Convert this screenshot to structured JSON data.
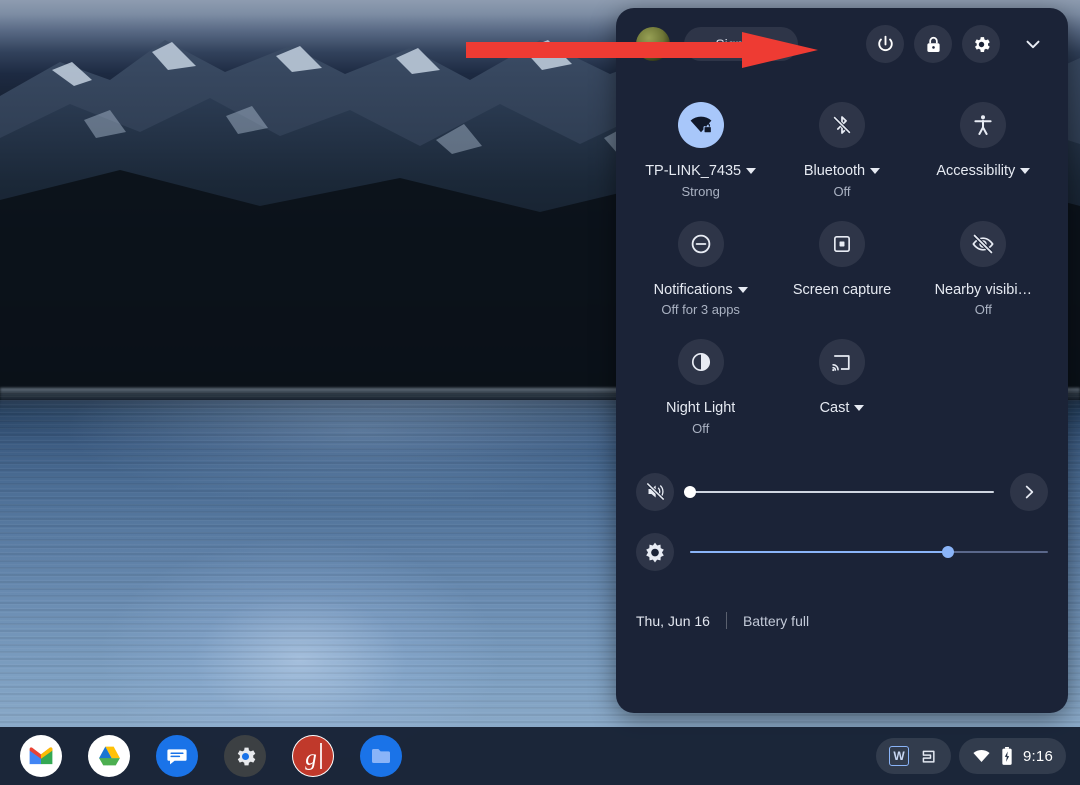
{
  "desktop": {
    "wallpaper_name": "mountain-lake-night-wallpaper"
  },
  "annotation": {
    "arrow_name": "red-pointer-arrow",
    "color": "#ee3b33",
    "points_at": "power-button"
  },
  "quick_settings": {
    "header": {
      "avatar_name": "user-avatar",
      "sign_out_label": "Sign out",
      "power_title": "Power",
      "lock_title": "Lock",
      "settings_title": "Settings",
      "collapse_title": "Collapse"
    },
    "tiles": [
      {
        "name": "network",
        "icon": "wifi-locked-icon",
        "label": "TP-LINK_7435",
        "sub": "Strong",
        "has_caret": true,
        "active": true
      },
      {
        "name": "bluetooth",
        "icon": "bluetooth-disabled-icon",
        "label": "Bluetooth",
        "sub": "Off",
        "has_caret": true,
        "active": false
      },
      {
        "name": "accessibility",
        "icon": "accessibility-icon",
        "label": "Accessibility",
        "sub": "",
        "has_caret": true,
        "active": false
      },
      {
        "name": "notifications",
        "icon": "do-not-disturb-icon",
        "label": "Notifications",
        "sub": "Off for 3 apps",
        "has_caret": true,
        "active": false
      },
      {
        "name": "screen-capture",
        "icon": "screen-capture-icon",
        "label": "Screen capture",
        "sub": "",
        "has_caret": false,
        "active": false
      },
      {
        "name": "nearby-visibility",
        "icon": "eye-off-icon",
        "label": "Nearby visibi…",
        "sub": "Off",
        "has_caret": false,
        "active": false
      },
      {
        "name": "night-light",
        "icon": "night-light-icon",
        "label": "Night Light",
        "sub": "Off",
        "has_caret": false,
        "active": false
      },
      {
        "name": "cast",
        "icon": "cast-icon",
        "label": "Cast",
        "sub": "",
        "has_caret": true,
        "active": false
      }
    ],
    "sliders": [
      {
        "name": "volume-slider",
        "icon": "volume-muted-icon",
        "value": 0,
        "trailing_icon": "chevron-right-icon"
      },
      {
        "name": "brightness-slider",
        "icon": "brightness-icon",
        "value": 72,
        "trailing_icon": ""
      }
    ],
    "footer": {
      "date": "Thu, Jun 16",
      "battery": "Battery full"
    }
  },
  "shelf": {
    "apps": [
      {
        "name": "gmail",
        "icon": "gmail-icon"
      },
      {
        "name": "google-drive",
        "icon": "drive-icon"
      },
      {
        "name": "messages",
        "icon": "messages-icon"
      },
      {
        "name": "settings",
        "icon": "settings-gear-icon"
      },
      {
        "name": "groovypost",
        "icon": "groovypost-g-icon"
      },
      {
        "name": "files",
        "icon": "files-folder-icon"
      }
    ],
    "tray": {
      "ime_label": "W",
      "tote_icon": "tote-icon",
      "wifi_icon": "wifi-icon",
      "battery_icon": "battery-charging-icon",
      "clock": "9:16"
    }
  }
}
